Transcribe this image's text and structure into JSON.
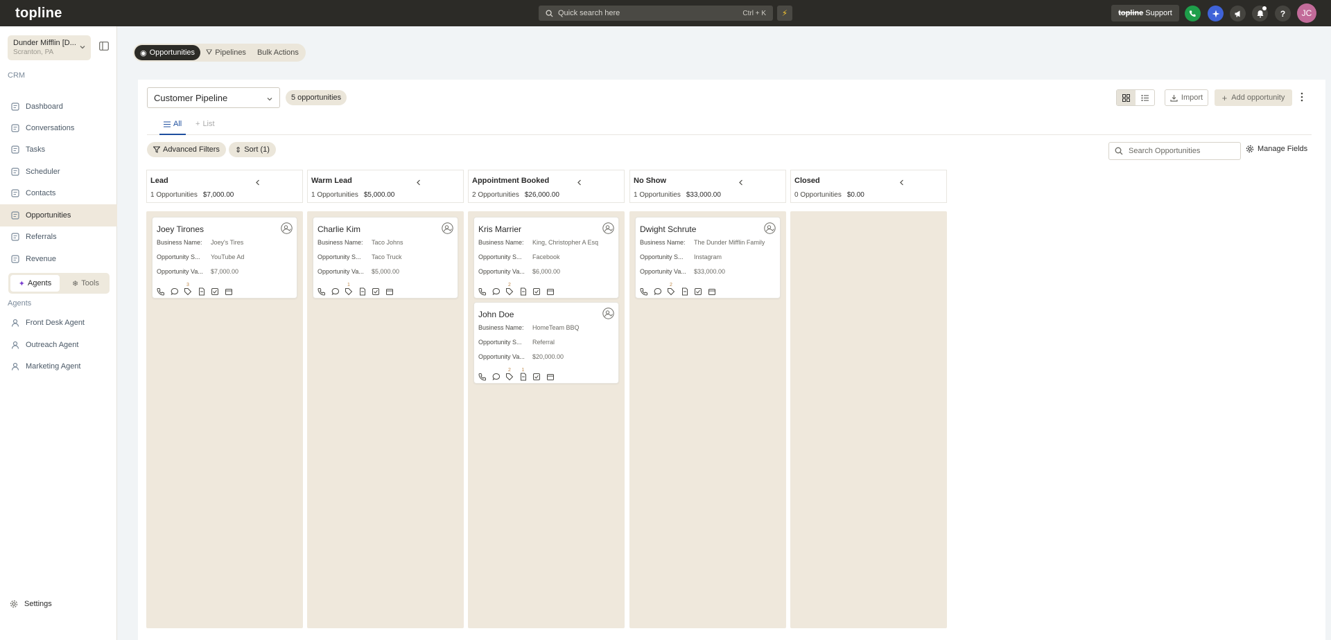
{
  "app": {
    "logo": "topline",
    "search_placeholder": "Quick search here",
    "search_shortcut": "Ctrl + K",
    "support_brand": "topline",
    "support_label": "Support",
    "avatar_initials": "JC",
    "colors": {
      "phone": "#1e9e4a",
      "ai": "#3f63d8",
      "avatar": "#c26b99"
    }
  },
  "sidebar": {
    "account_name": "Dunder Mifflin [D...",
    "account_location": "Scranton, PA",
    "section_crm": "CRM",
    "items": [
      {
        "label": "Dashboard",
        "icon": "dashboard-icon"
      },
      {
        "label": "Conversations",
        "icon": "conversations-icon"
      },
      {
        "label": "Tasks",
        "icon": "tasks-icon"
      },
      {
        "label": "Scheduler",
        "icon": "calendar-icon"
      },
      {
        "label": "Contacts",
        "icon": "contacts-icon"
      },
      {
        "label": "Opportunities",
        "icon": "target-icon"
      },
      {
        "label": "Referrals",
        "icon": "referrals-icon"
      },
      {
        "label": "Revenue",
        "icon": "revenue-icon"
      }
    ],
    "toggle": {
      "agents": "Agents",
      "tools": "Tools"
    },
    "section_agents": "Agents",
    "agents": [
      {
        "label": "Front Desk Agent"
      },
      {
        "label": "Outreach Agent"
      },
      {
        "label": "Marketing Agent"
      }
    ],
    "settings": "Settings"
  },
  "top_tabs": [
    "Opportunities",
    "Pipelines",
    "Bulk Actions"
  ],
  "toolbar": {
    "pipeline": "Customer Pipeline",
    "opp_count": "5 opportunities",
    "import": "Import",
    "add": "Add opportunity"
  },
  "subtabs": {
    "all": "All",
    "list": "List"
  },
  "filters": {
    "advanced": "Advanced Filters",
    "sort": "Sort (1)",
    "search_placeholder": "Search Opportunities",
    "manage": "Manage Fields"
  },
  "field_labels": {
    "business": "Business Name:",
    "source": "Opportunity S...",
    "value": "Opportunity Va..."
  },
  "columns": [
    {
      "title": "Lead",
      "count": "1 Opportunities",
      "total": "$7,000.00",
      "cards": [
        {
          "name": "Joey Tirones",
          "business": "Joey's Tires",
          "source": "YouTube Ad",
          "value": "$7,000.00",
          "badges": [
            "",
            "",
            "3",
            "",
            "",
            ""
          ]
        }
      ]
    },
    {
      "title": "Warm Lead",
      "count": "1 Opportunities",
      "total": "$5,000.00",
      "cards": [
        {
          "name": "Charlie Kim",
          "business": "Taco Johns",
          "source": "Taco Truck",
          "value": "$5,000.00",
          "badges": [
            "",
            "",
            "1",
            "",
            "",
            ""
          ]
        }
      ]
    },
    {
      "title": "Appointment Booked",
      "count": "2 Opportunities",
      "total": "$26,000.00",
      "cards": [
        {
          "name": "Kris Marrier",
          "business": "King, Christopher A Esq",
          "source": "Facebook",
          "value": "$6,000.00",
          "badges": [
            "",
            "",
            "2",
            "",
            "",
            ""
          ]
        },
        {
          "name": "John Doe",
          "business": "HomeTeam BBQ",
          "source": "Referral",
          "value": "$20,000.00",
          "badges": [
            "",
            "",
            "2",
            "1",
            "",
            ""
          ]
        }
      ]
    },
    {
      "title": "No Show",
      "count": "1 Opportunities",
      "total": "$33,000.00",
      "cards": [
        {
          "name": "Dwight Schrute",
          "business": "The Dunder Mifflin Family",
          "source": "Instagram",
          "value": "$33,000.00",
          "badges": [
            "",
            "",
            "2",
            "",
            "",
            ""
          ]
        }
      ]
    },
    {
      "title": "Closed",
      "count": "0 Opportunities",
      "total": "$0.00",
      "cards": []
    }
  ]
}
